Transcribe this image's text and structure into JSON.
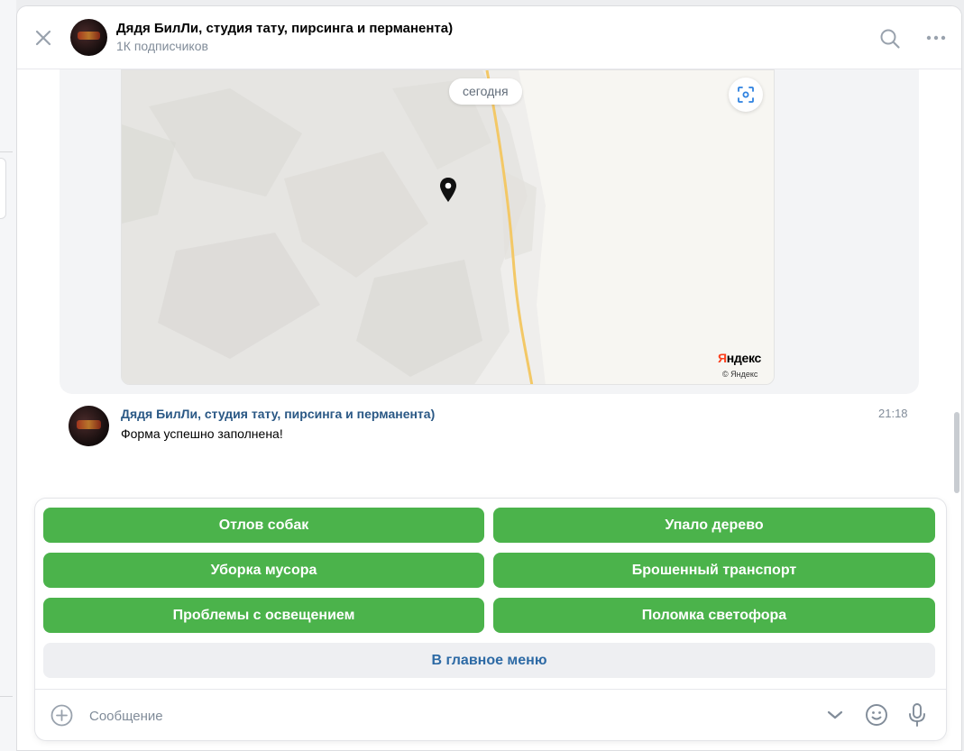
{
  "header": {
    "title": "Дядя БилЛи, студия тату, пирсинга и перманента)",
    "subtitle": "1К подписчиков"
  },
  "map": {
    "date_label": "сегодня",
    "logo": "Яндекс",
    "copyright": "© Яндекс"
  },
  "message": {
    "author": "Дядя БилЛи, студия тату, пирсинга и перманента)",
    "time": "21:18",
    "text": "Форма успешно заполнена!"
  },
  "keyboard": {
    "buttons": [
      "Отлов собак",
      "Упало дерево",
      "Уборка мусора",
      "Брошенный транспорт",
      "Проблемы с освещением",
      "Поломка светофора",
      "В главное меню"
    ]
  },
  "composer": {
    "placeholder": "Сообщение"
  },
  "colors": {
    "accent_green": "#4bb34b",
    "link_blue": "#2a5885",
    "menu_text": "#2d6aa5"
  }
}
